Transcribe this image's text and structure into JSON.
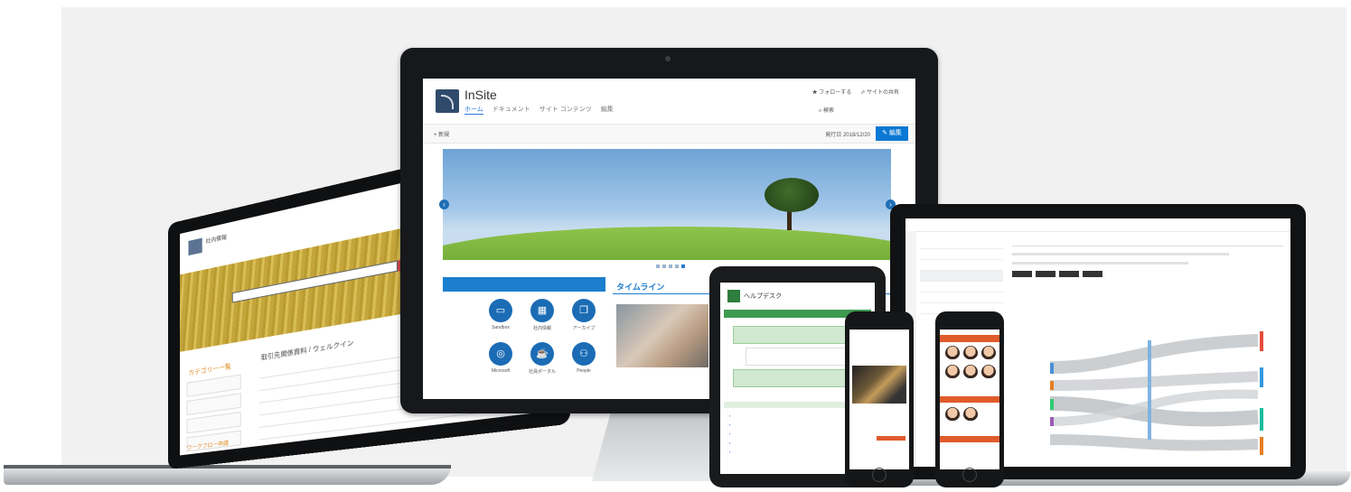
{
  "sharepoint": {
    "site_title": "InSite",
    "nav_tabs": [
      "ホーム",
      "ドキュメント",
      "サイト コンテンツ",
      "編集"
    ],
    "follow_label": "フォローする",
    "share_label": "サイトの共有",
    "search_label": "検索",
    "new_label": "+ 新規",
    "published_label": "発行日 2018/12/20",
    "edit_label": "編集",
    "quick_icons": [
      {
        "label": "Sandbox",
        "icon": "folder-icon"
      },
      {
        "label": "社内情報",
        "icon": "calendar-icon"
      },
      {
        "label": "アーカイブ",
        "icon": "copy-icon"
      },
      {
        "label": "Microsoft",
        "icon": "globe-icon"
      },
      {
        "label": "社員ポータル",
        "icon": "cup-icon"
      },
      {
        "label": "People",
        "icon": "people-icon"
      }
    ],
    "timeline_title": "タイムライン"
  },
  "left_laptop": {
    "site_title": "社内情報",
    "section_title": "取引先関係資料 / ウェルクイン",
    "side_title": "カテゴリー一覧",
    "orange_label": "ワークフロー申請"
  },
  "tablet": {
    "title": "ヘルプデスク",
    "header": "ヘルプデスク"
  },
  "colors": {
    "sharepoint_blue": "#1b7ecf",
    "edit_button": "#0a78d4",
    "helpdesk_green": "#3e9a4f",
    "phone_orange": "#e05b2b",
    "banner_gold": "#c4a53c"
  }
}
